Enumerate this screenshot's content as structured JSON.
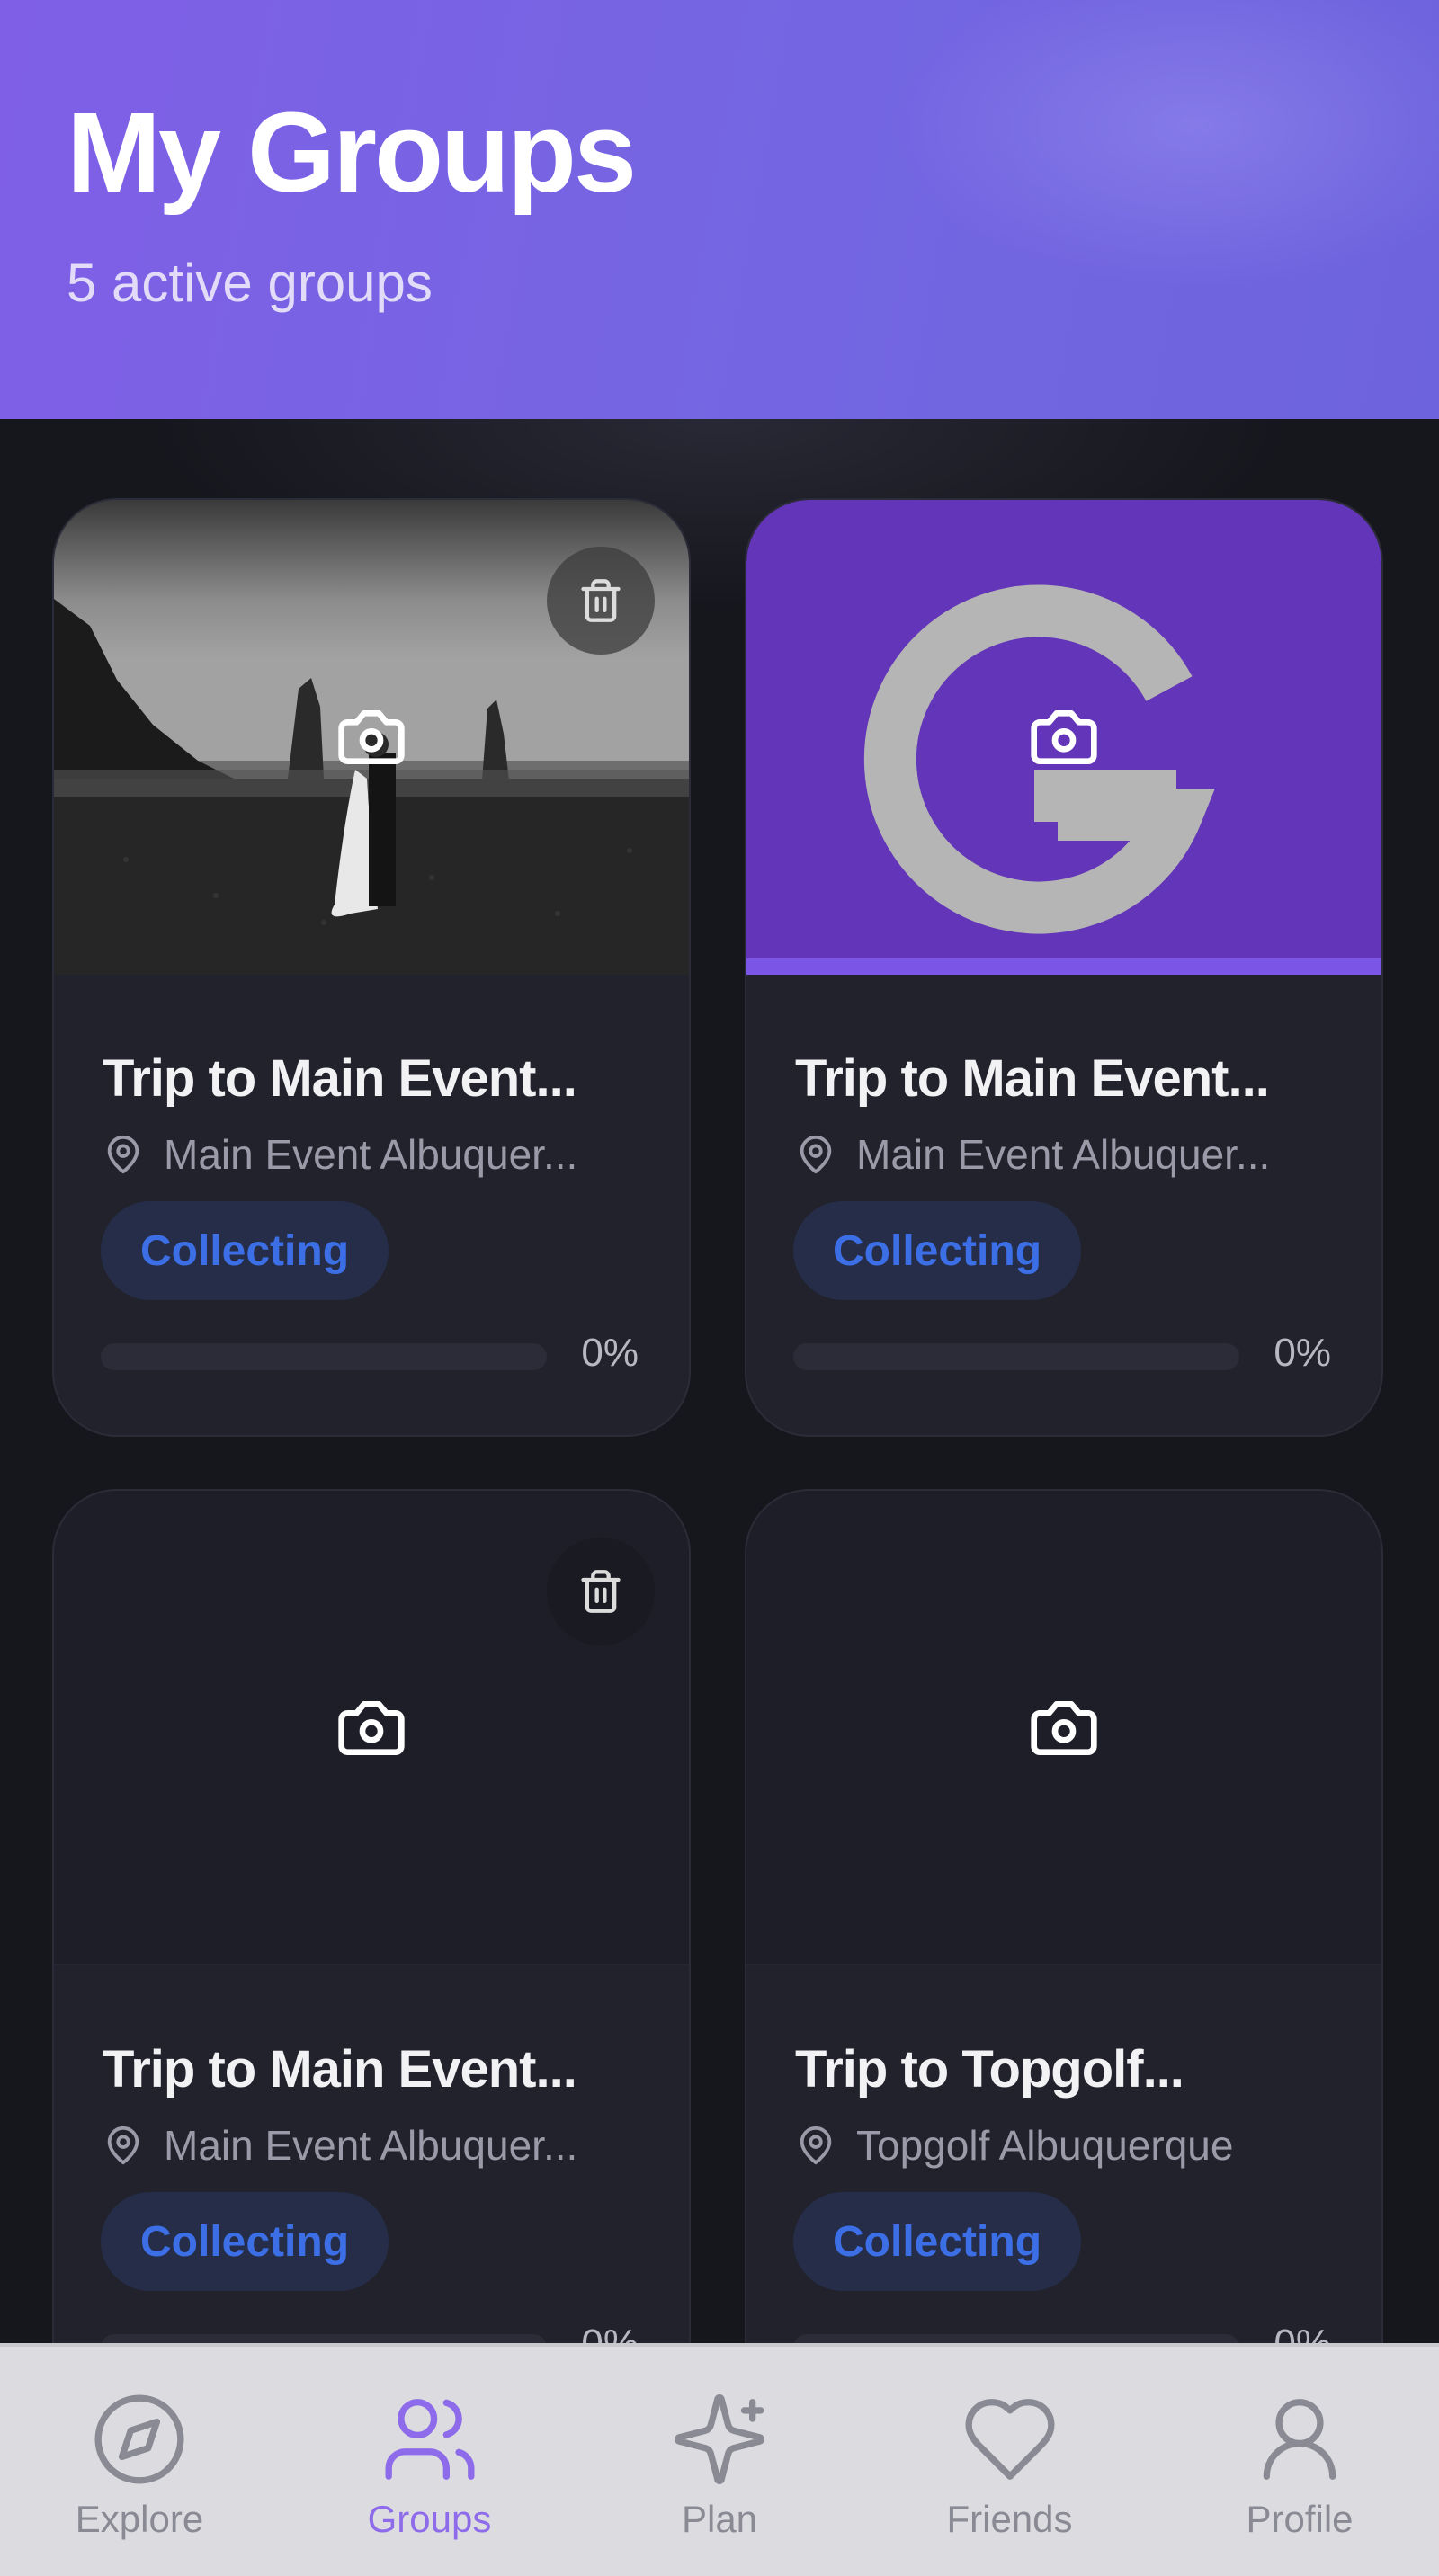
{
  "header": {
    "title": "My Groups",
    "subtitle": "5 active groups"
  },
  "colors": {
    "accent": "#8d6bea",
    "badge_text": "#3c6fe6",
    "card_bg": "#22222c",
    "page_bg": "#16161d"
  },
  "groups": [
    {
      "title": "Trip to Main Event...",
      "location": "Main Event Albuquer...",
      "status": "Collecting",
      "progress_label": "0%",
      "progress": 0,
      "image": "photo",
      "deletable": true
    },
    {
      "title": "Trip to Main Event...",
      "location": "Main Event Albuquer...",
      "status": "Collecting",
      "progress_label": "0%",
      "progress": 0,
      "image": "logo",
      "deletable": false
    },
    {
      "title": "Trip to Main Event...",
      "location": "Main Event Albuquer...",
      "status": "Collecting",
      "progress_label": "0%",
      "progress": 0,
      "image": "none",
      "deletable": true
    },
    {
      "title": "Trip to Topgolf...",
      "location": "Topgolf Albuquerque",
      "status": "Collecting",
      "progress_label": "0%",
      "progress": 0,
      "image": "none",
      "deletable": false
    }
  ],
  "nav": {
    "items": [
      {
        "label": "Explore",
        "icon": "compass-icon",
        "active": false
      },
      {
        "label": "Groups",
        "icon": "users-icon",
        "active": true
      },
      {
        "label": "Plan",
        "icon": "sparkles-icon",
        "active": false
      },
      {
        "label": "Friends",
        "icon": "heart-icon",
        "active": false
      },
      {
        "label": "Profile",
        "icon": "user-icon",
        "active": false
      }
    ]
  }
}
